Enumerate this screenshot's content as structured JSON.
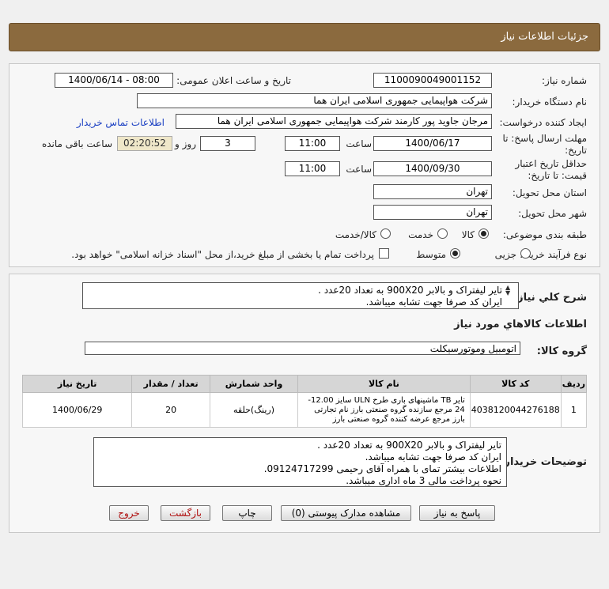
{
  "header": {
    "title": "جزئیات اطلاعات نیاز"
  },
  "form": {
    "need_number_label": "شماره نیاز:",
    "need_number": "1100090049001152",
    "announce_label": "تاریخ و ساعت اعلان عمومی:",
    "announce_value": "1400/06/14 - 08:00",
    "buyer_org_label": "نام دستگاه خریدار:",
    "buyer_org": "شرکت هواپیمایی جمهوری اسلامی ایران هما",
    "requester_label": "ایجاد کننده درخواست:",
    "requester": "مرجان جاوید پور کارمند شرکت هواپیمایی جمهوری اسلامی ایران هما",
    "contact_link": "اطلاعات تماس خریدار",
    "deadline_label_1": "مهلت ارسال پاسخ: تا",
    "deadline_label_2": "تاریخ:",
    "deadline_date": "1400/06/17",
    "time_label": "ساعت",
    "deadline_time": "11:00",
    "days_value": "3",
    "days_label": "روز و",
    "remaining_time": "02:20:52",
    "remaining_label": "ساعت باقی مانده",
    "validity_label_1": "حداقل تاریخ اعتبار",
    "validity_label_2": "قیمت: تا تاریخ:",
    "validity_date": "1400/09/30",
    "validity_time": "11:00",
    "province_label": "استان محل تحویل:",
    "province": "تهران",
    "city_label": "شهر محل تحویل:",
    "city": "تهران",
    "category_label": "طبقه بندی موضوعی:",
    "category_options": [
      "کالا",
      "خدمت",
      "کالا/خدمت"
    ],
    "category_selected": "کالا",
    "process_label": "نوع فرآیند خرید :",
    "process_options": [
      "جزیی",
      "متوسط"
    ],
    "process_selected": "متوسط",
    "payment_note": "پرداخت تمام یا بخشی از مبلغ خرید،از محل \"اسناد خزانه اسلامی\" خواهد بود."
  },
  "summary": {
    "label": "شرح کلي نياز:",
    "lines": [
      "تایر لیفتراک و بالابر 900X20 به تعداد 20عدد .",
      "ایران کد صرفا جهت تشابه میباشد."
    ]
  },
  "goods": {
    "section_title": "اطلاعات کالاهاي مورد نياز",
    "group_label": "گروه کالا:",
    "group_value": "اتومبیل وموتورسیکلت",
    "columns": [
      "ردیف",
      "کد کالا",
      "نام کالا",
      "واحد شمارش",
      "تعداد / مقدار",
      "تاریخ نیاز"
    ],
    "rows": [
      {
        "row": "1",
        "code": "4038120044276188",
        "name": "تایر TB ماشینهای باری طرح ULN سایز 12.00-24 مرجع سازنده گروه صنعتی بارز نام تجارتی بارز مرجع عرضه کننده گروه صنعتی بارز",
        "unit": "(رینگ)حلقه",
        "qty": "20",
        "date": "1400/06/29"
      }
    ]
  },
  "buyer_notes": {
    "label": "توضیحات خریدار:",
    "lines": [
      "تایر لیفتراک و بالابر 900X20 به تعداد 20عدد .",
      "ایران کد صرفا جهت تشابه میباشد.",
      "اطلاعات بیشتر تمای با همراه آقای رحیمی 09124717299.",
      "نحوه پرداخت مالی 3 ماه اداری میباشد."
    ]
  },
  "buttons": {
    "reply": "پاسخ به نیاز",
    "view_docs": "مشاهده مدارک پیوستی (0)",
    "print": "چاپ",
    "back": "بازگشت",
    "exit": "خروج"
  }
}
